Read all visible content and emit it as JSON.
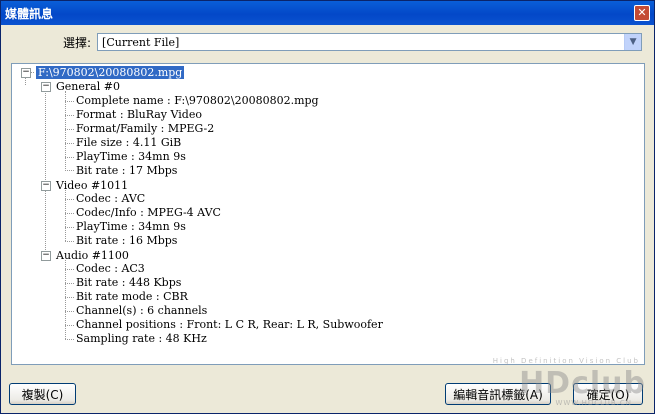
{
  "window": {
    "title": "媒體訊息",
    "close_label": "✕"
  },
  "selector": {
    "label": "選擇:",
    "value": "[Current File]"
  },
  "tree": {
    "root": "F:\\970802\\20080802.mpg",
    "sections": [
      {
        "label": "General #0",
        "items": [
          "Complete name : F:\\970802\\20080802.mpg",
          "Format : BluRay Video",
          "Format/Family : MPEG-2",
          "File size : 4.11 GiB",
          "PlayTime : 34mn 9s",
          "Bit rate : 17 Mbps"
        ]
      },
      {
        "label": "Video #1011",
        "items": [
          "Codec : AVC",
          "Codec/Info : MPEG-4 AVC",
          "PlayTime : 34mn 9s",
          "Bit rate : 16 Mbps"
        ]
      },
      {
        "label": "Audio #1100",
        "items": [
          "Codec : AC3",
          "Bit rate : 448 Kbps",
          "Bit rate mode : CBR",
          "Channel(s) : 6 channels",
          "Channel positions : Front: L C R, Rear: L R, Subwoofer",
          "Sampling rate : 48 KHz"
        ]
      }
    ]
  },
  "buttons": {
    "copy": "複製(C)",
    "edit": "編輯音訊標籤(A)",
    "ok": "確定(O)"
  },
  "watermark": {
    "main": "HDclub",
    "sub": "High Definition Vision Club",
    "url": "WWW.HDCLUB.CN"
  }
}
